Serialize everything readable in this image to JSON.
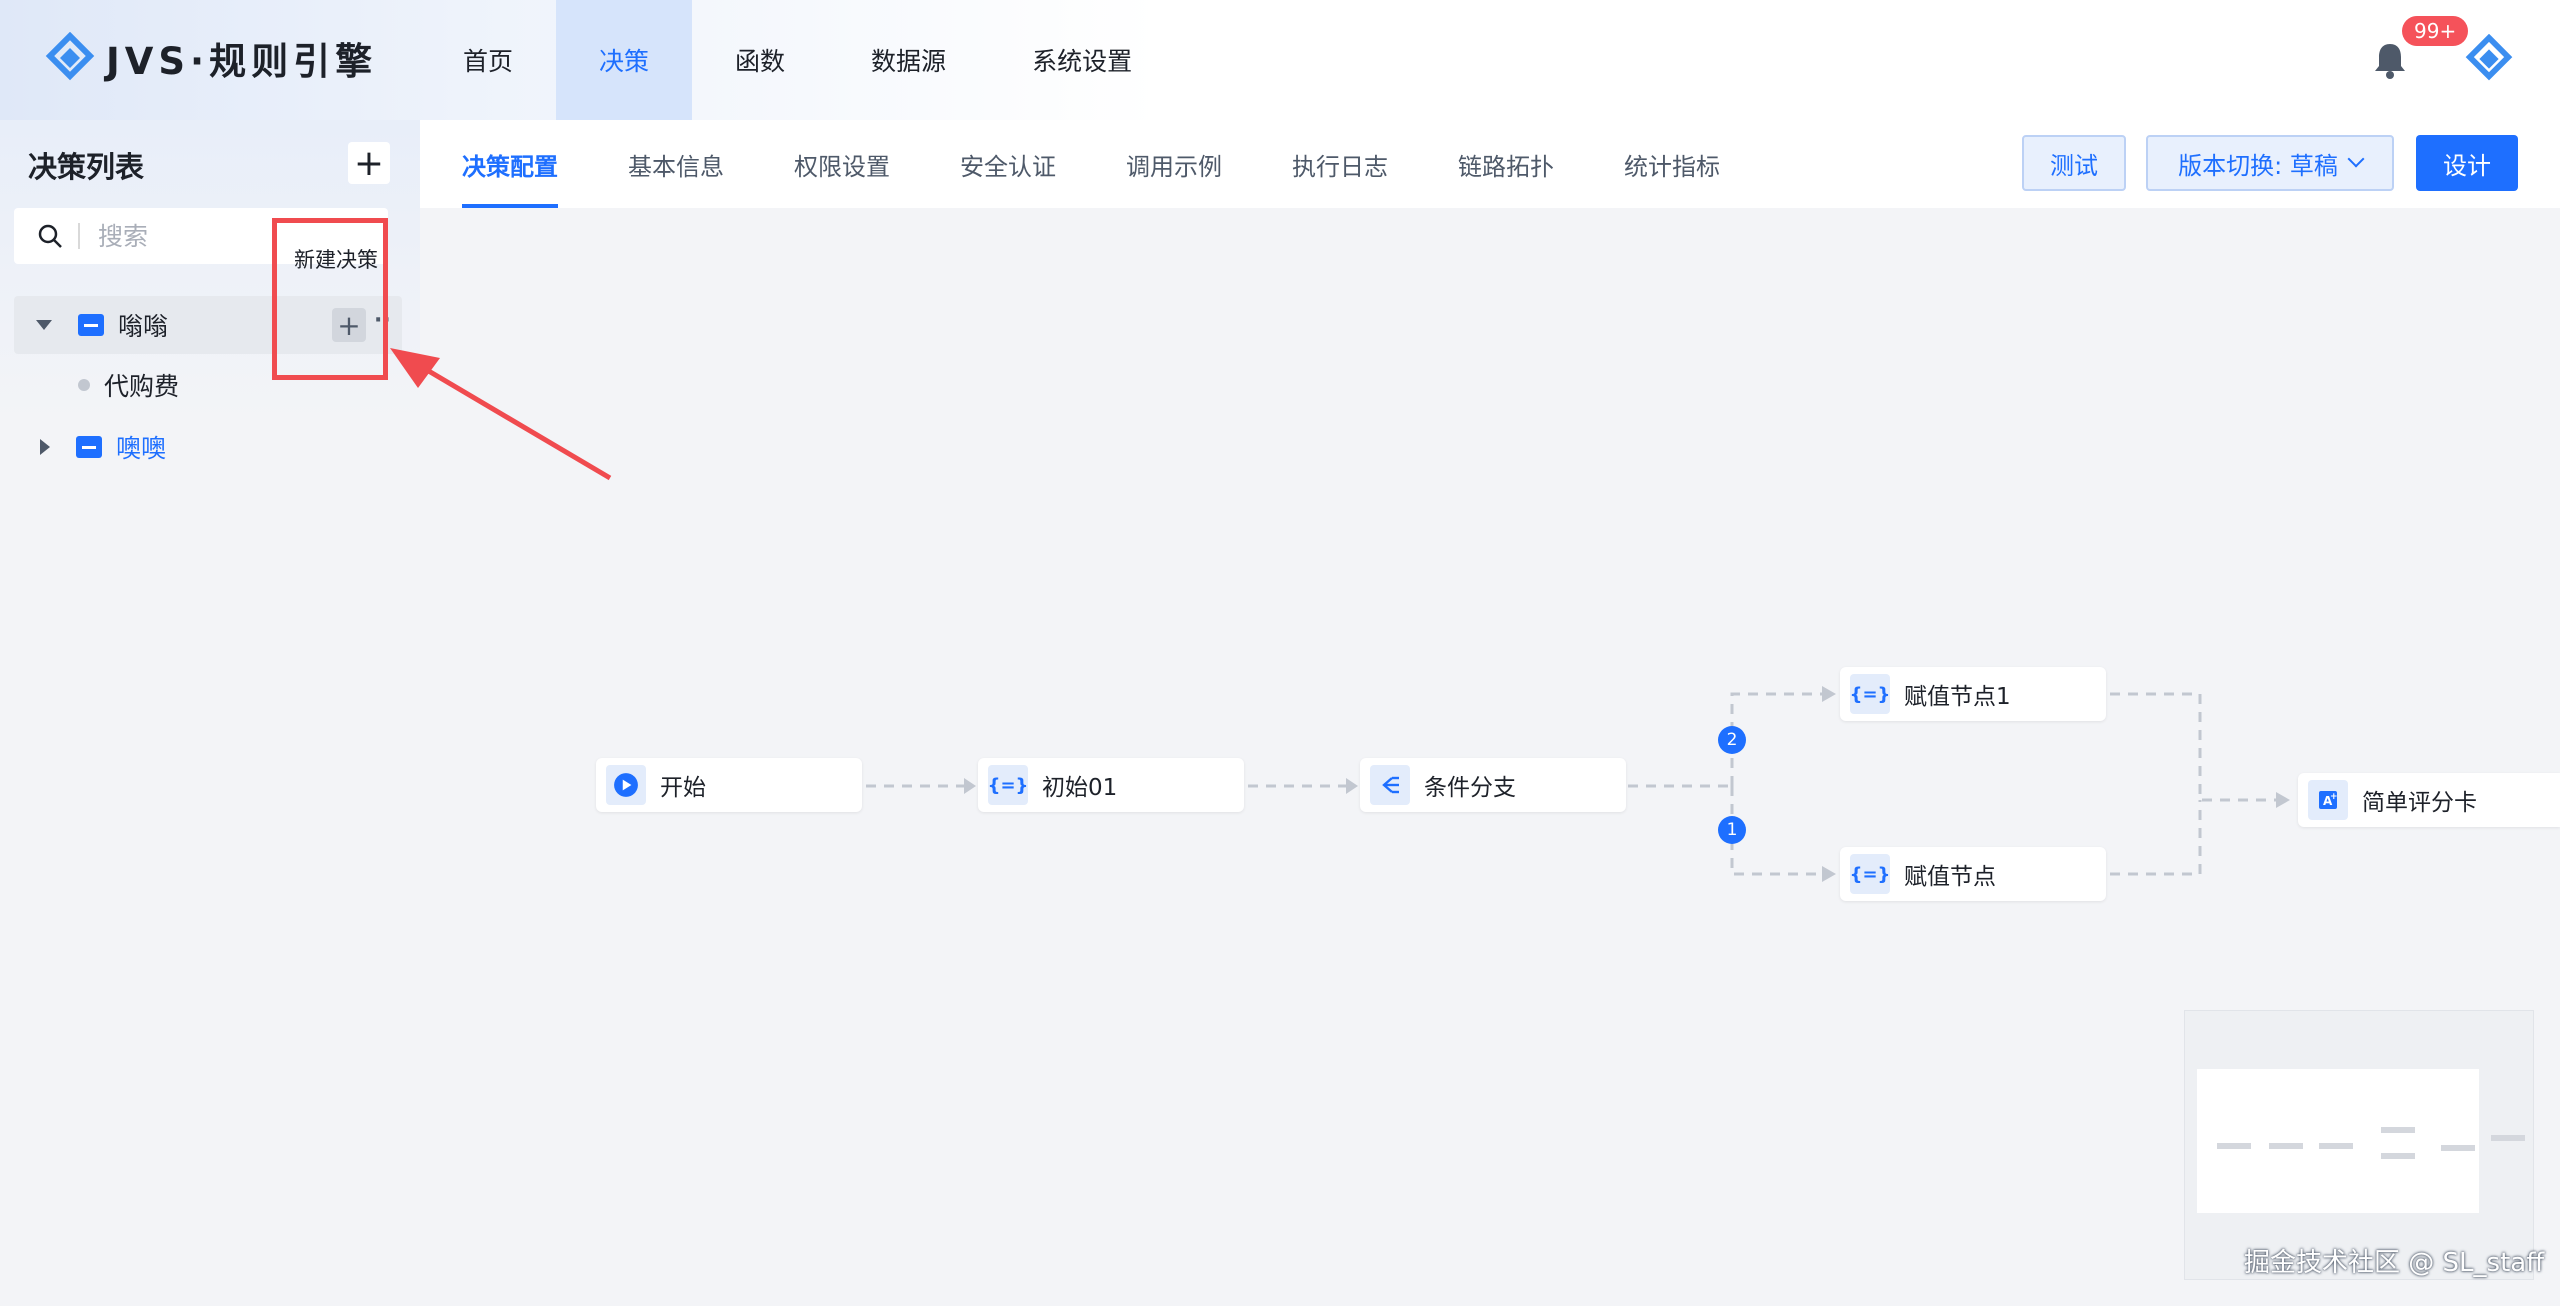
{
  "app": {
    "logo_text": "JVS·规则引擎",
    "notification_badge": "99+",
    "brand_color": "#1e6fff"
  },
  "topnav": {
    "items": [
      {
        "label": "首页"
      },
      {
        "label": "决策"
      },
      {
        "label": "函数"
      },
      {
        "label": "数据源"
      },
      {
        "label": "系统设置"
      }
    ],
    "active": "决策"
  },
  "sidebar": {
    "title": "决策列表",
    "search_placeholder": "搜索",
    "tooltip": "新建决策",
    "tree": [
      {
        "label": "嗡嗡",
        "expanded": true,
        "children": [
          {
            "label": "代购费"
          }
        ]
      },
      {
        "label": "噢噢",
        "expanded": false
      }
    ]
  },
  "tabs": {
    "items": [
      "决策配置",
      "基本信息",
      "权限设置",
      "安全认证",
      "调用示例",
      "执行日志",
      "链路拓扑",
      "统计指标"
    ],
    "active": "决策配置"
  },
  "actions": {
    "test": "测试",
    "version": "版本切换: 草稿",
    "design": "设计"
  },
  "flow": {
    "nodes": {
      "start": {
        "label": "开始",
        "icon": "play-icon"
      },
      "init": {
        "label": "初始01",
        "icon": "assign-icon"
      },
      "condition": {
        "label": "条件分支",
        "icon": "branch-icon"
      },
      "assign1": {
        "label": "赋值节点1",
        "icon": "assign-icon"
      },
      "assign": {
        "label": "赋值节点",
        "icon": "assign-icon"
      },
      "scorecard": {
        "label": "简单评分卡",
        "icon": "scorecard-icon"
      }
    },
    "branch_numbers": [
      "2",
      "1"
    ]
  },
  "watermark": "掘金技术社区 @ SL_staff"
}
